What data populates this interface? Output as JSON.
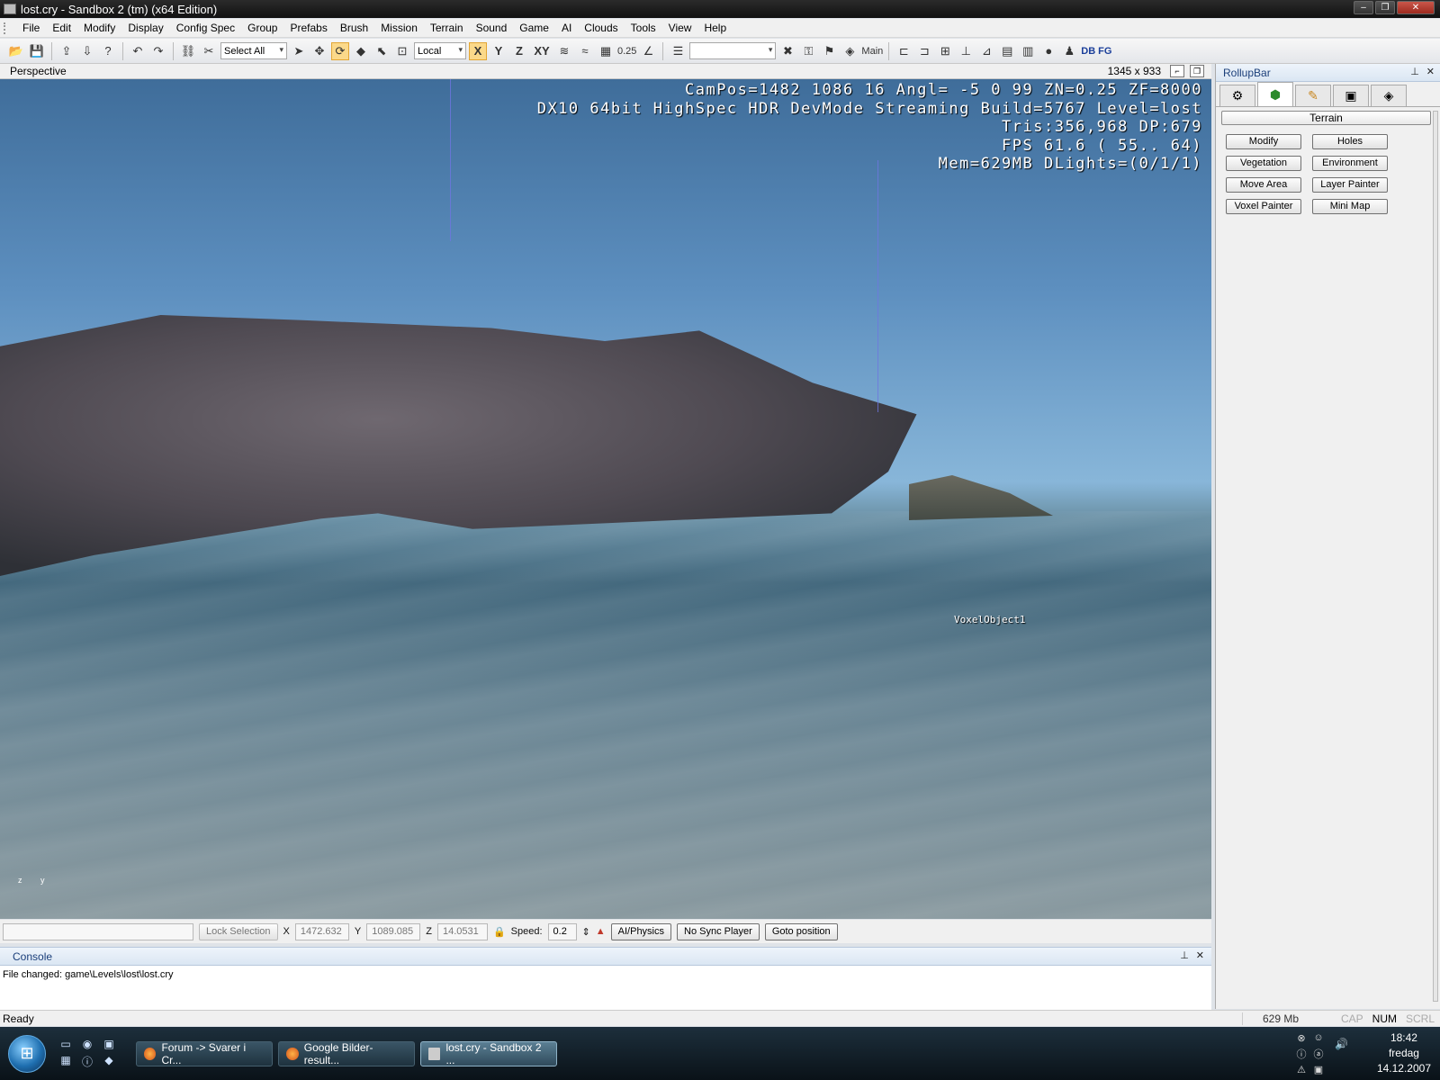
{
  "window": {
    "title": "lost.cry - Sandbox 2 (tm) (x64 Edition)",
    "buttons": [
      "–",
      "❐",
      "✕"
    ]
  },
  "menubar": [
    "File",
    "Edit",
    "Modify",
    "Display",
    "Config Spec",
    "Group",
    "Prefabs",
    "Brush",
    "Mission",
    "Terrain",
    "Sound",
    "Game",
    "AI",
    "Clouds",
    "Tools",
    "View",
    "Help"
  ],
  "toolbar": {
    "select_combo": "Select All",
    "coord_combo": "Local",
    "axis_x": "X",
    "axis_y": "Y",
    "axis_z": "Z",
    "axis_xy": "XY",
    "grid_value": "0.25",
    "layer_label": "Main",
    "db_label": "DB",
    "fg_label": "FG"
  },
  "viewport": {
    "title": "Perspective",
    "size": "1345 x 933",
    "hud": [
      "CamPos=1482 1086  16 Angl= -5  0  99 ZN=0.25 ZF=8000",
      "DX10 64bit HighSpec HDR DevMode Streaming Build=5767 Level=lost",
      "Tris:356,968  DP:679",
      "FPS  61.6 ( 55.. 64)",
      "Mem=629MB DLights=(0/1/1)"
    ],
    "object_label": "VoxelObject1",
    "axis_z": "z",
    "axis_y": "y"
  },
  "rollup": {
    "title": "RollupBar",
    "tabs": [
      "create-tab",
      "terrain-tab",
      "modify-tab",
      "display-tab",
      "layers-tab"
    ],
    "panel_title": "Terrain",
    "buttons": [
      "Modify",
      "Holes",
      "Vegetation",
      "Environment",
      "Move Area",
      "Layer Painter",
      "Voxel Painter",
      "Mini Map"
    ]
  },
  "status_row": {
    "lock_selection": "Lock Selection",
    "x_label": "X",
    "x_value": "1472.632",
    "y_label": "Y",
    "y_value": "1089.085",
    "z_label": "Z",
    "z_value": "14.0531",
    "speed_label": "Speed:",
    "speed_value": "0.2",
    "ai_physics": "AI/Physics",
    "no_sync": "No Sync Player",
    "goto": "Goto position"
  },
  "console": {
    "title": "Console",
    "line": "File changed: game\\Levels\\lost\\lost.cry"
  },
  "app_status": {
    "ready": "Ready",
    "memory": "629 Mb",
    "cap": "CAP",
    "num": "NUM",
    "scrl": "SCRL"
  },
  "taskbar": {
    "tasks": [
      "Forum -> Svarer i Cr...",
      "Google Bilder-result...",
      "lost.cry - Sandbox 2 ..."
    ],
    "time": "18:42",
    "day": "fredag",
    "date": "14.12.2007"
  }
}
